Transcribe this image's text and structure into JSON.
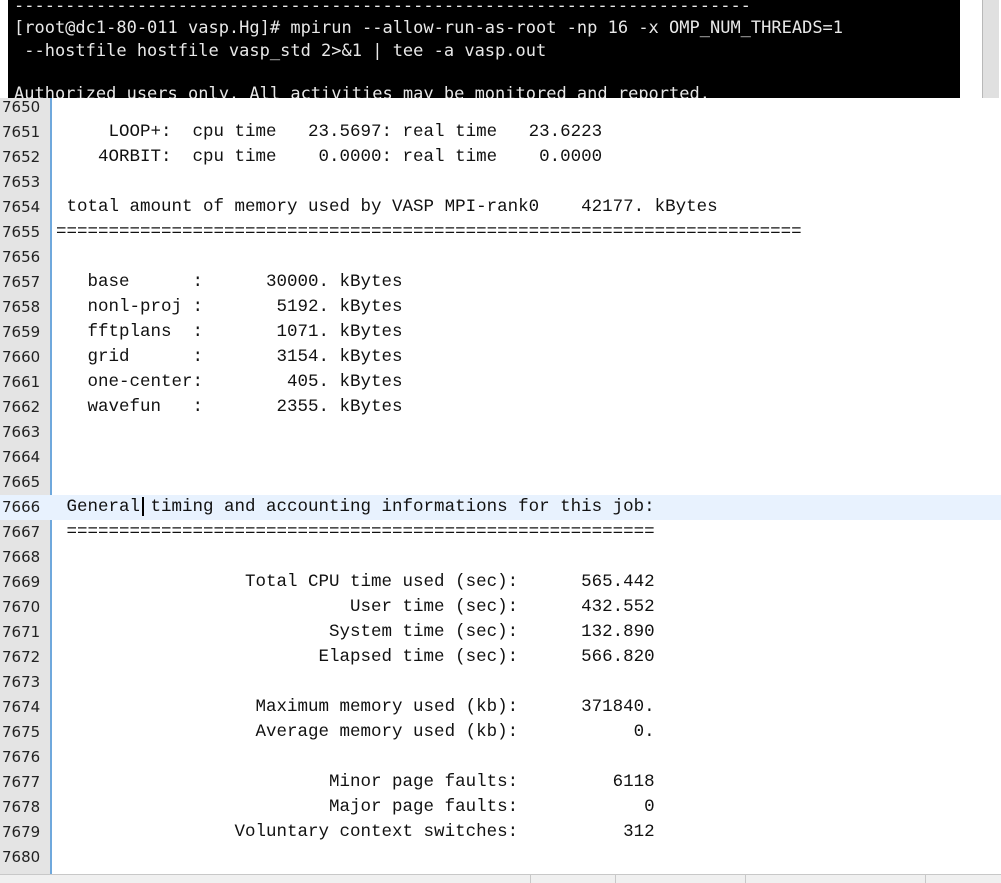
{
  "terminal": {
    "lines": [
      "------------------------------------------------------------------------",
      "[root@dc1-80-011 vasp.Hg]# mpirun --allow-run-as-root -np 16 -x OMP_NUM_THREADS=1",
      " --hostfile hostfile vasp_std 2>&1 | tee -a vasp.out",
      "",
      "Authorized users only. All activities may be monitored and reported."
    ]
  },
  "editor": {
    "current_line": "7666",
    "lines": [
      {
        "n": "7650",
        "t": ""
      },
      {
        "n": "7651",
        "t": "     LOOP+:  cpu time   23.5697: real time   23.6223"
      },
      {
        "n": "7652",
        "t": "    4ORBIT:  cpu time    0.0000: real time    0.0000"
      },
      {
        "n": "7653",
        "t": ""
      },
      {
        "n": "7654",
        "t": " total amount of memory used by VASP MPI-rank0    42177. kBytes"
      },
      {
        "n": "7655",
        "t": "======================================================================="
      },
      {
        "n": "7656",
        "t": ""
      },
      {
        "n": "7657",
        "t": "   base      :      30000. kBytes"
      },
      {
        "n": "7658",
        "t": "   nonl-proj :       5192. kBytes"
      },
      {
        "n": "7659",
        "t": "   fftplans  :       1071. kBytes"
      },
      {
        "n": "7660",
        "t": "   grid      :       3154. kBytes"
      },
      {
        "n": "7661",
        "t": "   one-center:        405. kBytes"
      },
      {
        "n": "7662",
        "t": "   wavefun   :       2355. kBytes"
      },
      {
        "n": "7663",
        "t": ""
      },
      {
        "n": "7664",
        "t": ""
      },
      {
        "n": "7665",
        "t": ""
      },
      {
        "n": "7666",
        "t": " General timing and accounting informations for this job:"
      },
      {
        "n": "7667",
        "t": " ========================================================"
      },
      {
        "n": "7668",
        "t": ""
      },
      {
        "n": "7669",
        "t": "                  Total CPU time used (sec):      565.442"
      },
      {
        "n": "7670",
        "t": "                            User time (sec):      432.552"
      },
      {
        "n": "7671",
        "t": "                          System time (sec):      132.890"
      },
      {
        "n": "7672",
        "t": "                         Elapsed time (sec):      566.820"
      },
      {
        "n": "7673",
        "t": ""
      },
      {
        "n": "7674",
        "t": "                   Maximum memory used (kb):      371840."
      },
      {
        "n": "7675",
        "t": "                   Average memory used (kb):           0."
      },
      {
        "n": "7676",
        "t": ""
      },
      {
        "n": "7677",
        "t": "                          Minor page faults:         6118"
      },
      {
        "n": "7678",
        "t": "                          Major page faults:            0"
      },
      {
        "n": "7679",
        "t": "                 Voluntary context switches:          312"
      },
      {
        "n": "7680",
        "t": ""
      }
    ]
  }
}
